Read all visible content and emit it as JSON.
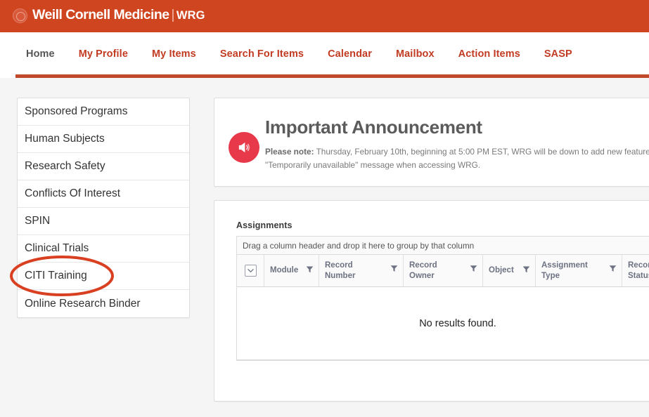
{
  "brand": {
    "logo_icon": "wcm-seal-icon",
    "name": "Weill Cornell Medicine",
    "separator": "|",
    "sub": "WRG",
    "bar_color": "#cf4520"
  },
  "nav": {
    "items": [
      {
        "label": "Home",
        "active": true
      },
      {
        "label": "My Profile",
        "active": false
      },
      {
        "label": "My Items",
        "active": false
      },
      {
        "label": "Search For Items",
        "active": false
      },
      {
        "label": "Calendar",
        "active": false
      },
      {
        "label": "Mailbox",
        "active": false
      },
      {
        "label": "Action Items",
        "active": false
      },
      {
        "label": "SASP",
        "active": false
      }
    ],
    "accent_color": "#c23b22",
    "underline_color": "#c0482b"
  },
  "sidebar": {
    "items": [
      {
        "label": "Sponsored Programs"
      },
      {
        "label": "Human Subjects"
      },
      {
        "label": "Research Safety"
      },
      {
        "label": "Conflicts Of Interest"
      },
      {
        "label": "SPIN"
      },
      {
        "label": "Clinical Trials"
      },
      {
        "label": "CITI Training"
      },
      {
        "label": "Online Research Binder"
      }
    ]
  },
  "announcement": {
    "icon": "megaphone-icon",
    "icon_color": "#e8394a",
    "title": "Important Announcement",
    "note_label": "Please note:",
    "line1": " Thursday, February 10th, beginning at 5:00 PM EST, WRG will be down to add new features to the",
    "line2": "\"Temporarily unavailable\" message when accessing WRG."
  },
  "assignments": {
    "title": "Assignments",
    "group_bar_text": "Drag a column header and drop it here to group by that column",
    "columns": [
      {
        "label": "",
        "icon": "select-all-chevron-icon",
        "filter": false
      },
      {
        "label": "Module",
        "filter": true
      },
      {
        "label": "Record Number",
        "filter": true
      },
      {
        "label": "Record Owner",
        "filter": true
      },
      {
        "label": "Object",
        "filter": true
      },
      {
        "label": "Assignment Type",
        "filter": true
      },
      {
        "label": "Record Status",
        "filter": false
      }
    ],
    "column_labels": {
      "module": "Module",
      "record_number_l1": "Record",
      "record_number_l2": "Number",
      "record_owner_l1": "Record",
      "record_owner_l2": "Owner",
      "object": "Object",
      "assignment_type_l1": "Assignment",
      "assignment_type_l2": "Type",
      "record_status_l1": "Record",
      "record_status_l2": "Status"
    },
    "rows": [],
    "empty_message": "No results found."
  },
  "annotation": {
    "shape": "ellipse",
    "color": "#d93f21",
    "targets": "CITI Training"
  }
}
